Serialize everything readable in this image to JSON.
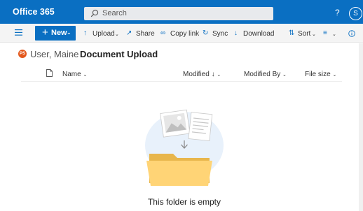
{
  "suite": {
    "app_title": "Office 365",
    "search_placeholder": "Search",
    "help": "?",
    "user_initial": "S"
  },
  "commands": {
    "new": "New",
    "upload": "Upload",
    "share": "Share",
    "copy_link": "Copy link",
    "sync": "Sync",
    "download": "Download",
    "sort": "Sort"
  },
  "breadcrumb": {
    "avatar_initials": "PS",
    "parent": "User, Maine",
    "current": "Document Upload"
  },
  "columns": {
    "name": "Name",
    "modified": "Modified",
    "modified_by": "Modified By",
    "file_size": "File size"
  },
  "empty_state": {
    "message": "This folder is empty"
  }
}
